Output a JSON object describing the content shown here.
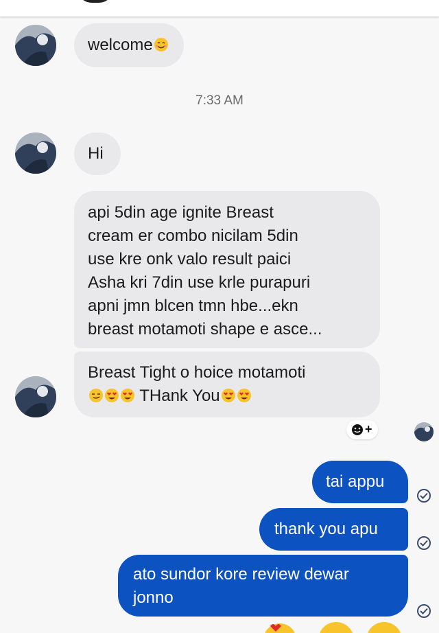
{
  "header": {},
  "conversation": {
    "timestamp": "7:33 AM",
    "incoming": [
      {
        "text": "welcome",
        "emoji": "smiling-face-emoji"
      },
      {
        "text": "Hi"
      },
      {
        "lines": [
          "api 5din age ignite Breast",
          "cream er combo nicilam 5din",
          "use kre onk valo result paici",
          "Asha kri 7din use krle purapuri",
          "apni jmn blcen tmn hbe...ekn",
          "breast motamoti shape e asce..."
        ]
      },
      {
        "line1": "Breast Tight o hoice motamoti",
        "line2": "THank You"
      }
    ],
    "outgoing": [
      {
        "text": "tai appu"
      },
      {
        "text": "thank you apu"
      },
      {
        "line1": "ato sundor kore review dewar",
        "line2": "jonno"
      }
    ],
    "reaction_button": {
      "icon": "add-reaction-icon",
      "label": "+"
    }
  },
  "colors": {
    "incoming_bubble": "#e9e9eb",
    "outgoing_bubble": "#0c52c1",
    "background": "#f7f7f7"
  }
}
